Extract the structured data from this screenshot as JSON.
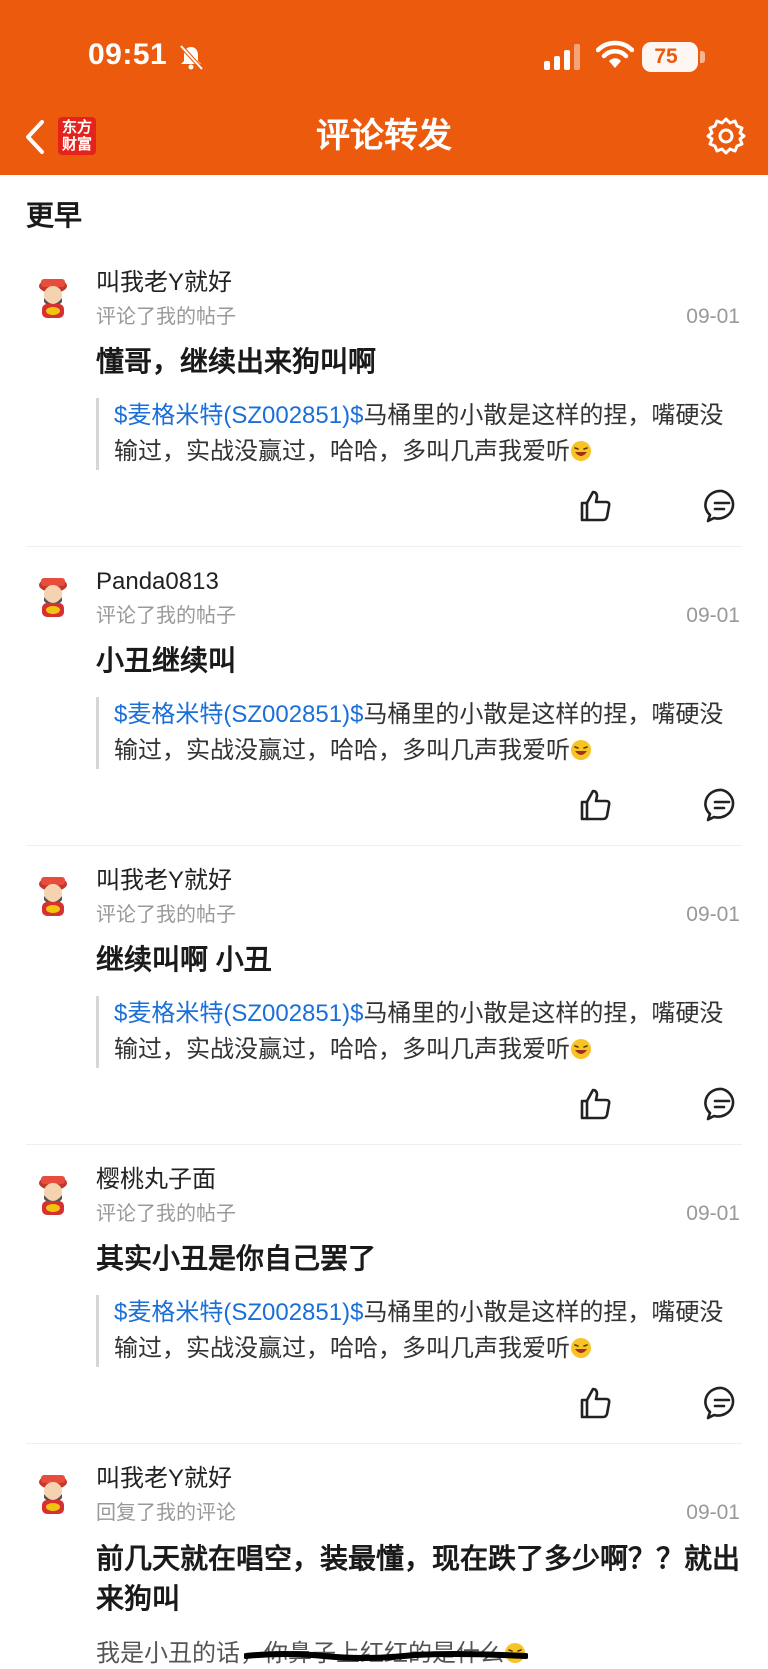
{
  "status_bar": {
    "time": "09:51",
    "battery": "75",
    "battery_level": 0.75
  },
  "nav": {
    "title": "评论转发",
    "logo_text_line1": "东方",
    "logo_text_line2": "财富"
  },
  "section": {
    "title": "更早"
  },
  "colors": {
    "header": "#EC5A0D",
    "stock_link": "#1a6fd8",
    "logo_red": "#E4231D",
    "muted": "#999999"
  },
  "items": [
    {
      "username": "叫我老Y就好",
      "action": "评论了我的帖子",
      "date": "09-01",
      "comment": "懂哥，继续出来狗叫啊",
      "quote_stock": "$麦格米特(SZ002851)$",
      "quote_text": "马桶里的小散是这样的捏，嘴硬没输过，实战没赢过，哈哈，多叫几声我爱听"
    },
    {
      "username": "Panda0813",
      "action": "评论了我的帖子",
      "date": "09-01",
      "comment": "小丑继续叫",
      "quote_stock": "$麦格米特(SZ002851)$",
      "quote_text": "马桶里的小散是这样的捏，嘴硬没输过，实战没赢过，哈哈，多叫几声我爱听"
    },
    {
      "username": "叫我老Y就好",
      "action": "评论了我的帖子",
      "date": "09-01",
      "comment": "继续叫啊 小丑",
      "quote_stock": "$麦格米特(SZ002851)$",
      "quote_text": "马桶里的小散是这样的捏，嘴硬没输过，实战没赢过，哈哈，多叫几声我爱听"
    },
    {
      "username": "樱桃丸子面",
      "action": "评论了我的帖子",
      "date": "09-01",
      "comment": "其实小丑是你自己罢了",
      "quote_stock": "$麦格米特(SZ002851)$",
      "quote_text": "马桶里的小散是这样的捏，嘴硬没输过，实战没赢过，哈哈，多叫几声我爱听"
    }
  ],
  "last_item": {
    "username": "叫我老Y就好",
    "action": "回复了我的评论",
    "date": "09-01",
    "comment": "前几天就在唱空，装最懂，现在跌了多少啊？？就出来狗叫",
    "reply_text": "我是小丑的话，你鼻子上红红的是什么"
  },
  "icons": [
    "back-icon",
    "gear-icon",
    "bell-muted-icon",
    "signal-icon",
    "wifi-icon",
    "like-icon",
    "reply-icon",
    "laughing-emoji-icon",
    "fortune-god-avatar"
  ]
}
